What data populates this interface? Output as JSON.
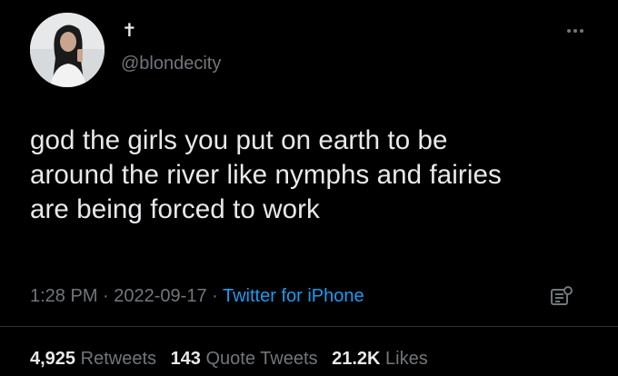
{
  "tweet": {
    "display_name": "✝",
    "handle": "@blondecity",
    "text": "god the girls you put on earth to be\naround the river like nymphs and fairies\nare being forced to work",
    "time": "1:28 PM",
    "separator": " · ",
    "date": "2022-09-17",
    "source": "Twitter for iPhone",
    "more_icon": "more-horizontal-icon",
    "analytics_icon": "analytics-icon"
  },
  "stats": {
    "retweets_count": "4,925",
    "retweets_label": "Retweets",
    "quotes_count": "143",
    "quotes_label": "Quote Tweets",
    "likes_count": "21.2K",
    "likes_label": "Likes"
  },
  "colors": {
    "background": "#000000",
    "primary_text": "#e7e9ea",
    "secondary_text": "#71767b",
    "link": "#1d9bf0",
    "divider": "#2f3336"
  }
}
